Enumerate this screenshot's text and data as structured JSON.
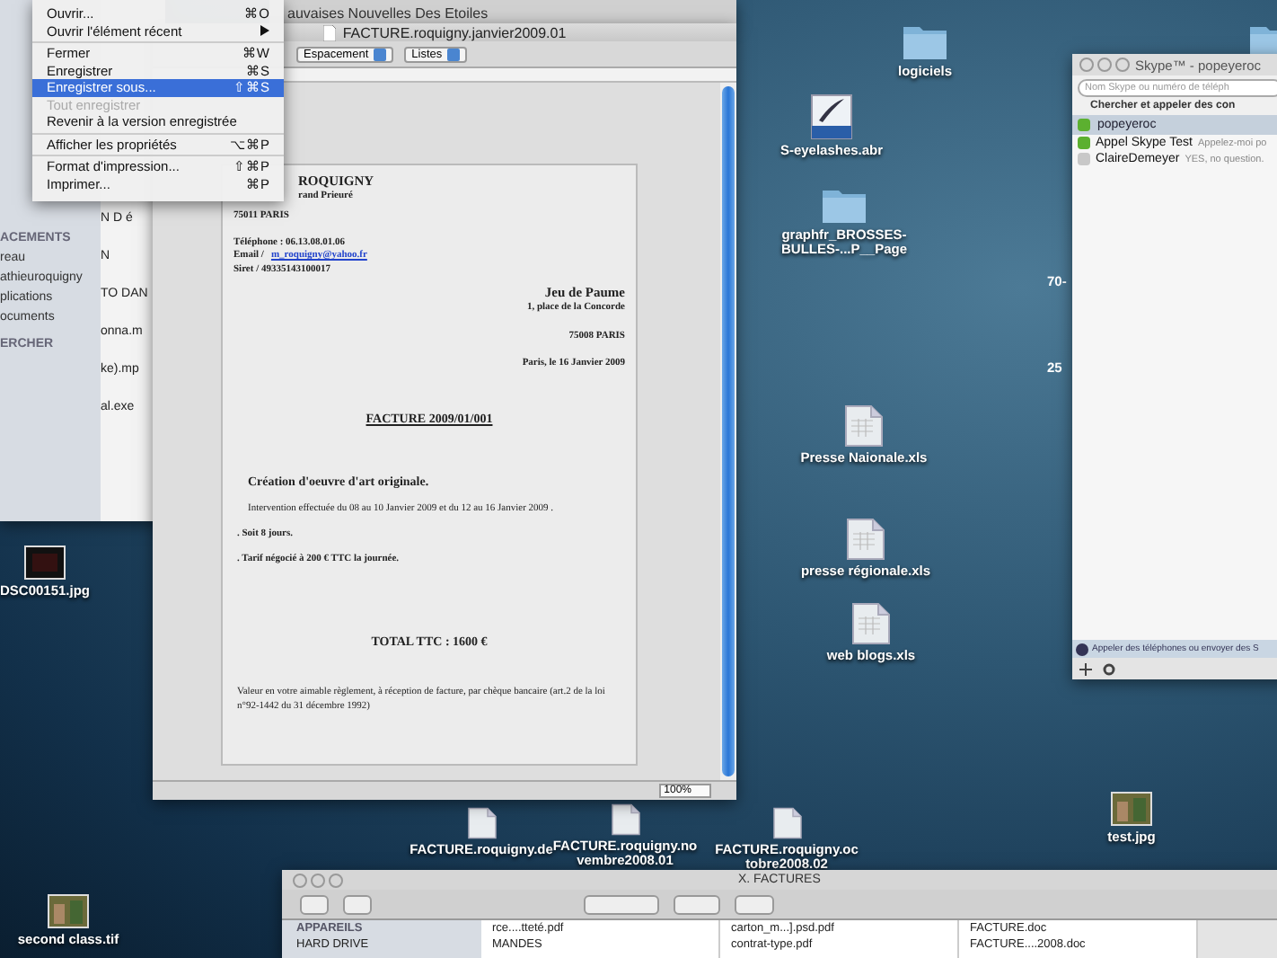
{
  "menu": {
    "groups": [
      [
        {
          "label": "Ouvrir...",
          "shortcut": "⌘O",
          "kind": "item",
          "selected": false,
          "disabled": false
        },
        {
          "label": "Ouvrir l'élément récent",
          "kind": "submenu",
          "selected": false,
          "disabled": false
        }
      ],
      [
        {
          "label": "Fermer",
          "shortcut": "⌘W",
          "kind": "item",
          "selected": false,
          "disabled": false
        },
        {
          "label": "Enregistrer",
          "shortcut": "⌘S",
          "kind": "item",
          "selected": false,
          "disabled": false
        },
        {
          "label": "Enregistrer sous...",
          "shortcut": "⇧⌘S",
          "kind": "item",
          "selected": true,
          "disabled": false
        },
        {
          "label": "Tout enregistrer",
          "kind": "item",
          "selected": false,
          "disabled": true
        },
        {
          "label": "Revenir à la version enregistrée",
          "kind": "item",
          "selected": false,
          "disabled": false
        }
      ],
      [
        {
          "label": "Afficher les propriétés",
          "shortcut": "⌥⌘P",
          "kind": "item",
          "selected": false,
          "disabled": false
        }
      ],
      [
        {
          "label": "Format d'impression...",
          "shortcut": "⇧⌘P",
          "kind": "item",
          "selected": false,
          "disabled": false
        },
        {
          "label": "Imprimer...",
          "shortcut": "⌘P",
          "kind": "item",
          "selected": false,
          "disabled": false
        }
      ]
    ]
  },
  "left_finder": {
    "sidebar": [
      {
        "label": "ACEMENTS",
        "kind": "header"
      },
      {
        "label": "reau",
        "kind": "item"
      },
      {
        "label": "athieuroquigny",
        "kind": "item"
      },
      {
        "label": "plications",
        "kind": "item"
      },
      {
        "label": "ocuments",
        "kind": "item"
      },
      {
        "label": "ERCHER",
        "kind": "header"
      }
    ],
    "files": [
      "N D é",
      "N",
      "TO DAN",
      "onna.m",
      "ke).mp",
      "al.exe"
    ]
  },
  "back_window": {
    "title": "auvaises Nouvelles Des Etoiles"
  },
  "document_window": {
    "title": "FACTURE.roquigny.janvier2009.01",
    "toolbar": [
      "Espacement",
      "Listes"
    ],
    "zoom": "100%",
    "page": [
      {
        "kind": "sender_name",
        "text": "ROQUIGNY"
      },
      {
        "kind": "sender",
        "text": "rand Prieuré"
      },
      {
        "kind": "sender_bold",
        "text": "75011 PARIS"
      },
      {
        "kind": "gap"
      },
      {
        "kind": "sender",
        "text": "Téléphone : 06.13.08.01.06"
      },
      {
        "kind": "email",
        "text": "Email / ",
        "link": "m_roquigny@yahoo.fr"
      },
      {
        "kind": "sender",
        "text": "Siret / 49335143100017"
      },
      {
        "kind": "recipient_name",
        "text": "Jeu de Paume"
      },
      {
        "kind": "recipient",
        "text": "1, place de la Concorde"
      },
      {
        "kind": "gap"
      },
      {
        "kind": "recipient",
        "text": "75008 PARIS"
      },
      {
        "kind": "gap"
      },
      {
        "kind": "date",
        "text": "Paris, le 16 Janvier 2009"
      },
      {
        "kind": "title",
        "text": "FACTURE 2009/01/001"
      },
      {
        "kind": "heading",
        "text": "Création d'oeuvre d'art originale."
      },
      {
        "kind": "body",
        "text": "Intervention effectuée du 08 au 10 Janvier 2009 et du 12 au 16 Janvier 2009 ."
      },
      {
        "kind": "bullet",
        "text": ". Soit 8 jours."
      },
      {
        "kind": "bullet",
        "text": ". Tarif négocié à 200 € TTC la journée."
      },
      {
        "kind": "total",
        "text": "TOTAL TTC : 1600 €"
      },
      {
        "kind": "footer",
        "text": "Valeur en votre aimable règlement, à réception de facture, par chèque bancaire  (art.2 de la loi n°92-1442 du 31 décembre 1992)"
      }
    ]
  },
  "desktop_icons": [
    {
      "kind": "folder",
      "label": "logiciels"
    },
    {
      "kind": "brush",
      "label": "S-eyelashes.abr"
    },
    {
      "kind": "folder",
      "label": "graphfr_BROSSES-BULLES-...P__Page"
    },
    {
      "kind": "sheet",
      "label": "Presse Naionale.xls"
    },
    {
      "kind": "sheet",
      "label": "presse régionale.xls"
    },
    {
      "kind": "sheet",
      "label": "web blogs.xls"
    },
    {
      "kind": "image",
      "label": "DSC00151.jpg"
    },
    {
      "kind": "doc",
      "label": "FACTURE.roquigny.de"
    },
    {
      "kind": "doc",
      "label": "FACTURE.roquigny.no vembre2008.01"
    },
    {
      "kind": "doc",
      "label": "FACTURE.roquigny.oc tobre2008.02"
    },
    {
      "kind": "photo",
      "label": "test.jpg"
    },
    {
      "kind": "photo",
      "label": "second class.tif"
    },
    {
      "kind": "folder"
    }
  ],
  "desktop_fragments": [
    "70-",
    "25"
  ],
  "skype": {
    "title": "Skype™ - popeyeroc",
    "search_placeholder": "Nom Skype ou numéro de téléph",
    "search_button": "Chercher et appeler des con",
    "user": "popeyeroc",
    "contacts": [
      {
        "name": "Appel Skype Test",
        "mood": "Appelez-moi po",
        "online": true
      },
      {
        "name": "ClaireDemeyer",
        "mood": "YES, no question.",
        "online": false
      }
    ],
    "footer": "Appeler des téléphones ou envoyer des S"
  },
  "bottom_finder": {
    "title": "X. FACTURES",
    "sidebar": [
      "APPAREILS",
      "HARD DRIVE"
    ],
    "columns": [
      [
        "rce....tteté.pdf",
        "MANDES"
      ],
      [
        "carton_m...].psd.pdf",
        "contrat-type.pdf"
      ],
      [
        "FACTURE.doc",
        "FACTURE....2008.doc"
      ]
    ]
  }
}
